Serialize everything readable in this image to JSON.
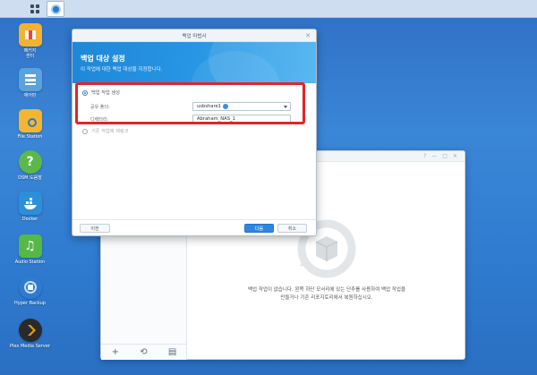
{
  "taskbar": {
    "main_menu_icon": "grid-icon",
    "open_app_icon": "hyper-backup-icon"
  },
  "desktop": {
    "icons": [
      {
        "label": "패키지\n센터",
        "icon": "package-center-icon",
        "color": "#f2b233"
      },
      {
        "label": "제어판",
        "icon": "control-panel-icon",
        "color": "#5aa2de"
      },
      {
        "label": "File Station",
        "icon": "folder-icon",
        "color": "#f4b630"
      },
      {
        "label": "DSM 도움말",
        "icon": "help-icon",
        "color": "#5cb84a"
      },
      {
        "label": "Docker",
        "icon": "docker-icon",
        "color": "#2c8fd8"
      },
      {
        "label": "Audio Station",
        "icon": "audio-icon",
        "color": "#55b946"
      },
      {
        "label": "Hyper Backup",
        "icon": "hyper-backup-icon",
        "color": "#2f7bd0"
      },
      {
        "label": "Plex Media Server",
        "icon": "plex-icon",
        "color": "#2a2a2a"
      }
    ]
  },
  "backup_app": {
    "window_controls": [
      "?",
      "—",
      "□",
      "✕"
    ],
    "empty_message": "백업 작업이 없습니다. 왼쪽 하단 모서리에 있는 단추를 사용하여 백업 작업을 만들거나 기존 리포지토리에서 복원하십시오.",
    "bottom_buttons": [
      "+",
      "⟲",
      "▤"
    ]
  },
  "wizard": {
    "title": "백업 마법사",
    "close": "✕",
    "heading": "백업 대상 설정",
    "subheading": "이 작업에 대한 백업 대상을 지정합니다.",
    "option_new": "백업 작업 생성",
    "shared_folder_label": "공유 폴더:",
    "shared_folder_value": "usbshare1",
    "directory_label": "디렉터리:",
    "directory_value": "Abraham_NAS_1",
    "option_existing": "기존 작업에 재링크",
    "prev_label": "이전",
    "next_label": "다음",
    "cancel_label": "취소"
  },
  "colors": {
    "accent": "#2e86de",
    "highlight_border": "#e52424"
  }
}
